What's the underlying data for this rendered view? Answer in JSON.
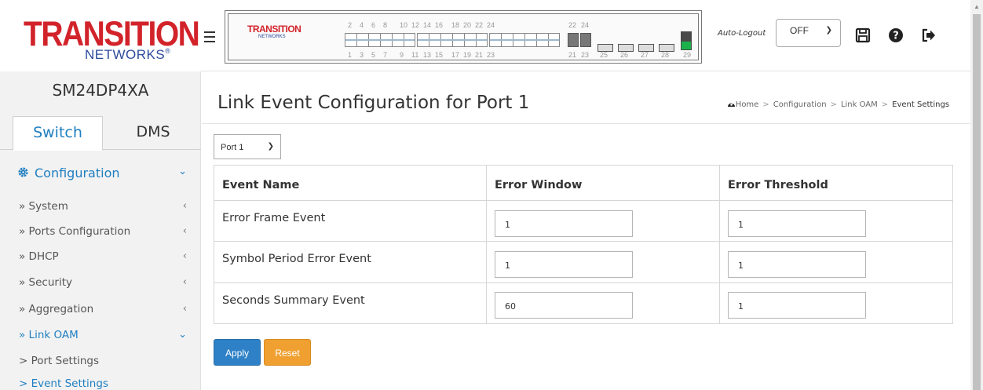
{
  "header": {
    "logo_main": "TRANSITION",
    "logo_sub": "NETWORKS",
    "logo_reg": "®",
    "auto_logout_label": "Auto-Logout",
    "auto_logout_value": "OFF",
    "icons": [
      "menu-icon",
      "save-icon",
      "help-icon",
      "logout-icon"
    ]
  },
  "device_panel": {
    "logo_main": "TRANSITION",
    "logo_sub": "NETWORKS",
    "top_port_numbers": [
      "2",
      "4",
      "6",
      "8",
      "10",
      "12",
      "14",
      "16",
      "18",
      "20",
      "22",
      "24",
      "22",
      "24"
    ],
    "bottom_port_numbers": [
      "1",
      "3",
      "5",
      "7",
      "9",
      "11",
      "13",
      "15",
      "17",
      "19",
      "21",
      "23",
      "21",
      "23",
      "25",
      "26",
      "27",
      "28",
      "29"
    ],
    "active_port_color": "#1bb24b"
  },
  "sidebar": {
    "device_name": "SM24DP4XA",
    "tabs": [
      {
        "label": "Switch",
        "active": true
      },
      {
        "label": "DMS",
        "active": false
      }
    ],
    "section": {
      "label": "Configuration",
      "icon": "gear-icon"
    },
    "items": [
      {
        "label": "» System"
      },
      {
        "label": "» Ports Configuration"
      },
      {
        "label": "» DHCP"
      },
      {
        "label": "» Security"
      },
      {
        "label": "» Aggregation"
      },
      {
        "label": "» Link OAM",
        "expanded": true
      },
      {
        "label": "> Port Settings"
      },
      {
        "label": "> Event Settings",
        "active": true
      }
    ]
  },
  "main": {
    "title": "Link Event Configuration for  Port 1",
    "breadcrumb": [
      "Home",
      "Configuration",
      "Link OAM",
      "Event Settings"
    ],
    "port_select_value": "Port 1",
    "table": {
      "headers": [
        "Event Name",
        "Error Window",
        "Error Threshold"
      ],
      "rows": [
        {
          "name": "Error Frame Event",
          "window": "1",
          "threshold": "1"
        },
        {
          "name": "Symbol Period Error Event",
          "window": "1",
          "threshold": "1"
        },
        {
          "name": "Seconds Summary Event",
          "window": "60",
          "threshold": "1"
        }
      ]
    },
    "apply_label": "Apply",
    "reset_label": "Reset"
  },
  "colors": {
    "accent_blue": "#1f7fc1",
    "apply_button": "#2e81c6",
    "reset_button": "#f0a030",
    "brand_red": "#d2232a",
    "brand_blue": "#2c4a9b"
  }
}
